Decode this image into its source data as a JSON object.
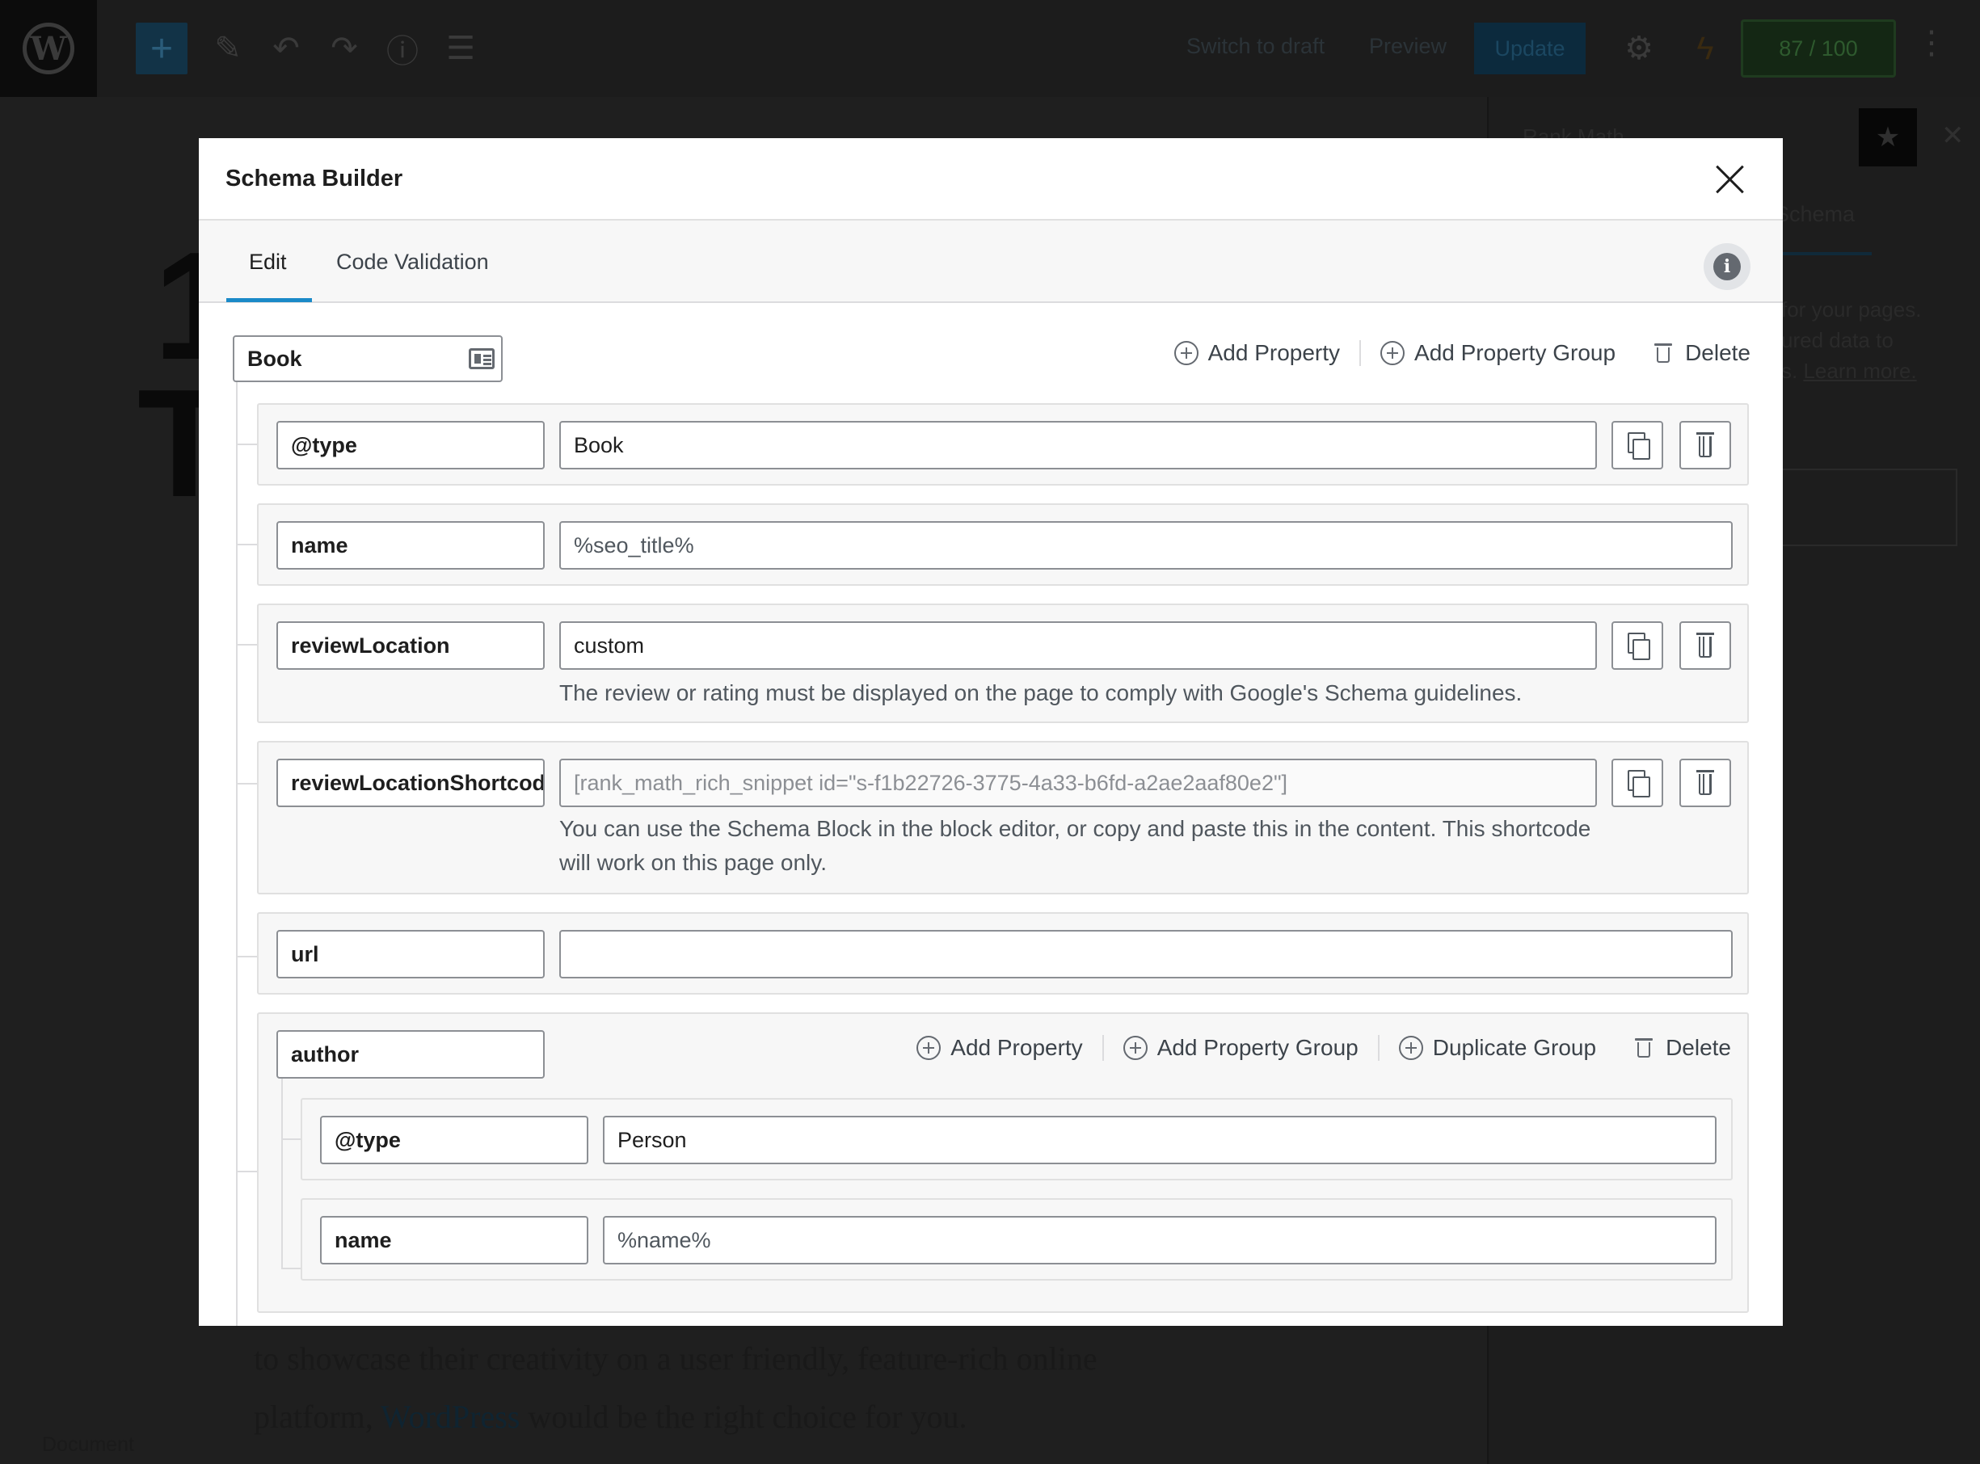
{
  "background": {
    "toolbar": {
      "switch_to_draft": "Switch to draft",
      "preview": "Preview",
      "update": "Update",
      "score": "87 / 100"
    },
    "sidebar": {
      "title": "Rank Math",
      "tab_schema": "Schema",
      "para_line1": "for your pages.",
      "para_line2": "ured data to",
      "para_line3_prefix": "s.",
      "para_link": "Learn more."
    },
    "content": {
      "line1": "to showcase their creativity on a user friendly, feature-rich online",
      "line2_start": "platform,",
      "line2_link": "WordPress",
      "line2_end": "would be the right choice for you.",
      "document_label": "Document"
    }
  },
  "modal": {
    "title": "Schema Builder",
    "tabs": [
      {
        "label": "Edit",
        "active": true
      },
      {
        "label": "Code Validation",
        "active": false
      }
    ],
    "root": {
      "name": "Book",
      "actions": {
        "add_property": "Add Property",
        "add_property_group": "Add Property Group",
        "delete": "Delete"
      }
    },
    "properties": [
      {
        "key": "@type",
        "value": "Book"
      },
      {
        "key": "name",
        "value": "%seo_title%"
      },
      {
        "key": "reviewLocation",
        "value": "custom",
        "help": "The review or rating must be displayed on the page to comply with Google's Schema guidelines."
      },
      {
        "key": "reviewLocationShortcode",
        "value": "[rank_math_rich_snippet id=\"s-f1b22726-3775-4a33-b6fd-a2ae2aaf80e2\"]",
        "help": "You can use the Schema Block in the block editor, or copy and paste this in the content. This shortcode will work on this page only."
      },
      {
        "key": "url",
        "value": ""
      }
    ],
    "author_group": {
      "key": "author",
      "actions": {
        "add_property": "Add Property",
        "add_property_group": "Add Property Group",
        "duplicate_group": "Duplicate Group",
        "delete": "Delete"
      },
      "properties": [
        {
          "key": "@type",
          "value": "Person"
        },
        {
          "key": "name",
          "value": "%name%"
        }
      ]
    }
  }
}
